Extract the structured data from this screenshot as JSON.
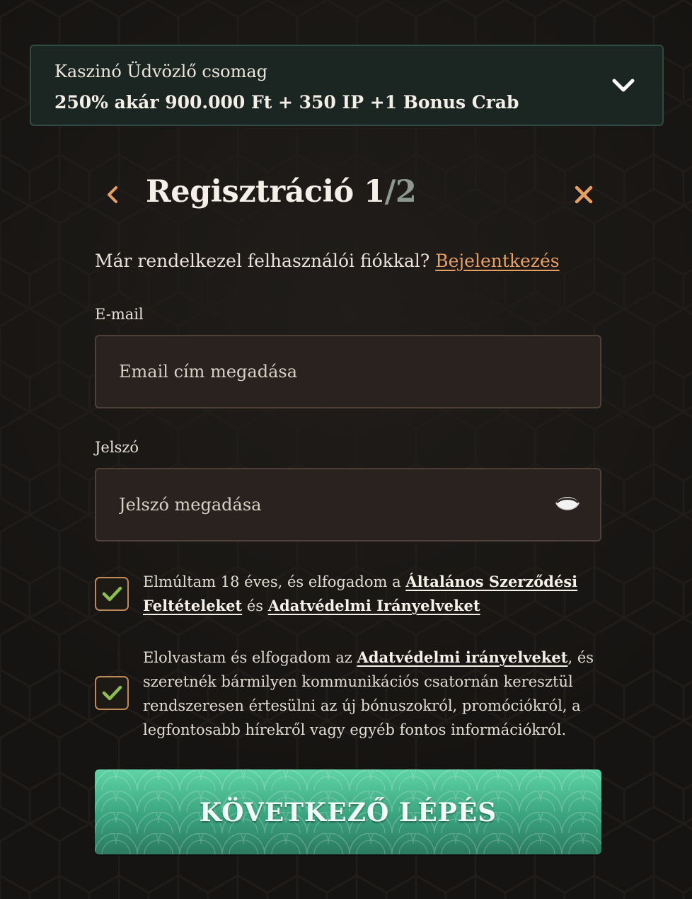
{
  "bonus_banner": {
    "title": "Kaszinó Üdvözlő csomag",
    "offer": "250% akár 900.000 Ft + 350 IP +1 Bonus Crab",
    "icon": "chevron-down-icon"
  },
  "header": {
    "title": "Regisztráció",
    "step_current": "1",
    "step_total": "/2",
    "back_icon": "chevron-left-icon",
    "close_icon": "close-icon"
  },
  "login_prompt": {
    "text": "Már rendelkezel felhasználói fiókkal?",
    "link": "Bejelentkezés"
  },
  "email": {
    "label": "E-mail",
    "placeholder": "Email cím megadása",
    "value": ""
  },
  "password": {
    "label": "Jelszó",
    "placeholder": "Jelszó megadása",
    "value": "",
    "toggle_icon": "eye-icon"
  },
  "consent_terms": {
    "checked": true,
    "text_before": "Elmúltam 18 éves, és elfogadom a",
    "terms_link": "Általános Szerződési Feltételeket",
    "text_middle": "és",
    "privacy_link": "Adatvédelmi Irányelveket"
  },
  "consent_marketing": {
    "checked": true,
    "text_before": "Elolvastam és elfogadom az",
    "privacy_link": "Adatvédelmi irányelveket",
    "text_after": ", és szeretnék bármilyen kommunikációs csatornán keresztül rendszeresen értesülni az új bónuszokról, promóciókról, a legfontosabb hírekről vagy egyéb fontos információkról."
  },
  "next_button": {
    "label": "KÖVETKEZŐ LÉPÉS"
  },
  "colors": {
    "background": "#161412",
    "banner_bg": "#1b2623",
    "accent_orange": "#e8a060",
    "input_bg": "#2a221e",
    "checkbox_border": "#c08a58",
    "check_green": "#8cc04a",
    "button_green": "#3aa37f"
  }
}
